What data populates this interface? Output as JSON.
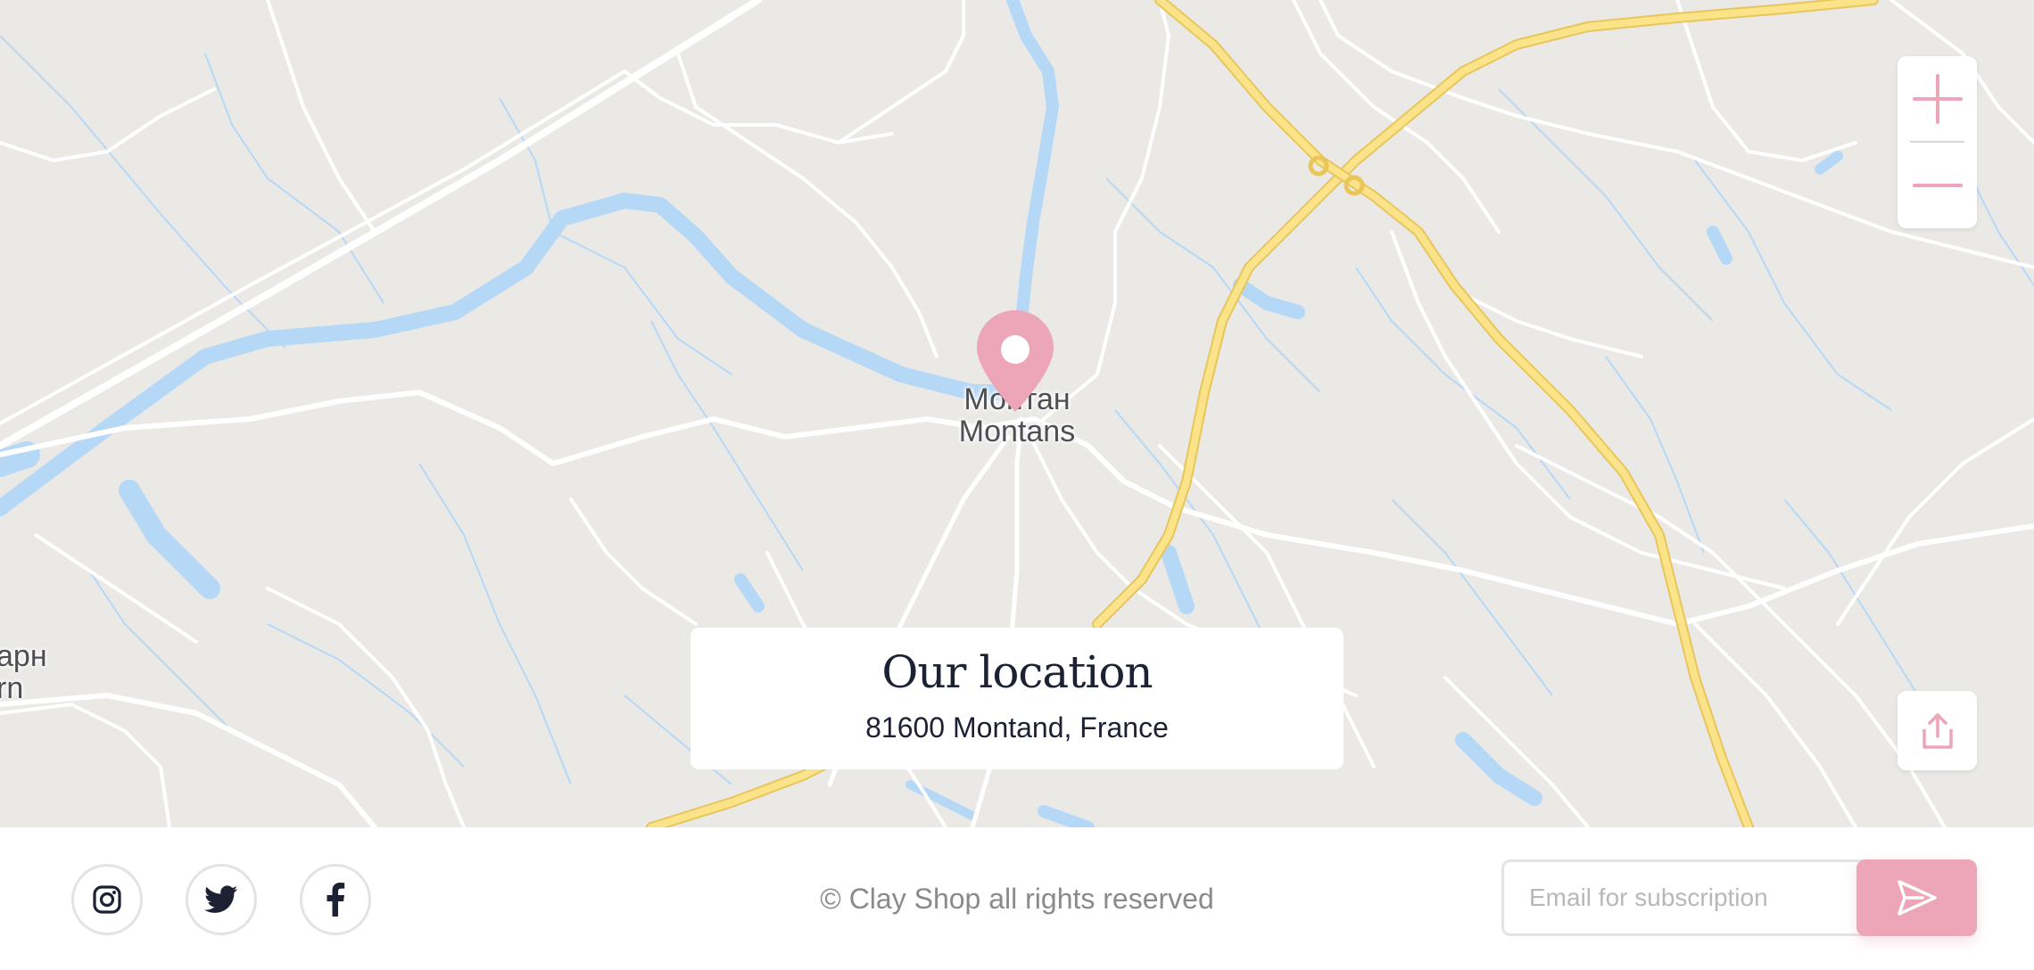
{
  "map": {
    "place_label_primary": "Монтан",
    "place_label_secondary": "Montans",
    "edge_label_primary": "арн",
    "edge_label_secondary": "rn",
    "colors": {
      "land": "#eae9e6",
      "water": "#b6d8f7",
      "road": "#ffffff",
      "highway": "#fbe38a",
      "accent": "#eda5b8"
    }
  },
  "controls": {
    "zoom_in_icon": "plus-icon",
    "zoom_out_icon": "minus-icon",
    "share_icon": "share-icon",
    "pin_icon": "map-pin-icon"
  },
  "location": {
    "title": "Our location",
    "address": "81600 Montand, France"
  },
  "footer": {
    "social": [
      {
        "icon": "instagram-icon"
      },
      {
        "icon": "twitter-icon"
      },
      {
        "icon": "facebook-icon"
      }
    ],
    "copyright": "© Clay Shop all rights reserved",
    "subscribe_placeholder": "Email for subscription",
    "send_icon": "send-icon"
  }
}
